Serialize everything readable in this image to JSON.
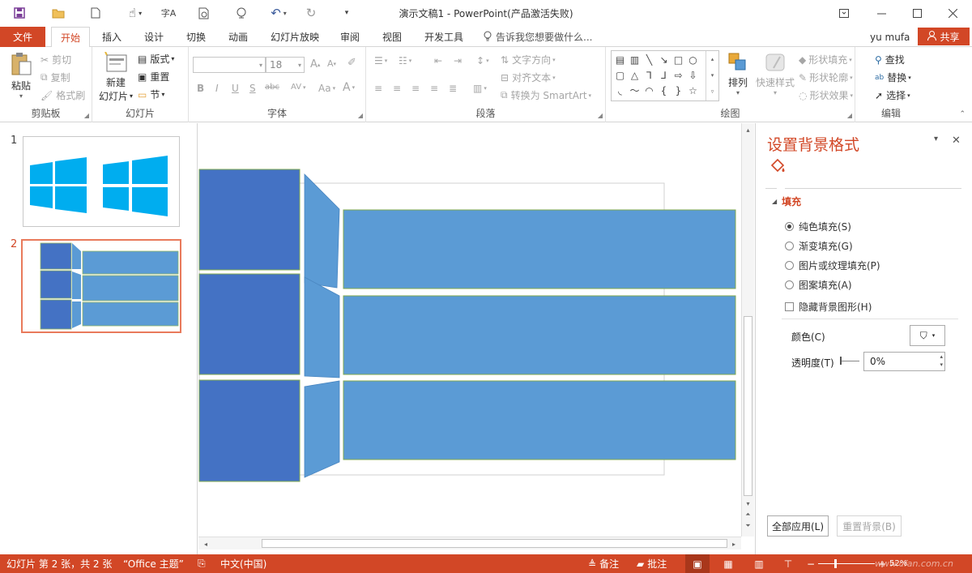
{
  "title_bar": {
    "title": "演示文稿1 - PowerPoint(产品激活失败)",
    "quick_access": [
      "save-icon",
      "open-icon",
      "new-icon",
      "touch-icon",
      "spelling-icon",
      "print-preview-icon",
      "present-icon",
      "undo-icon",
      "redo-icon",
      "customize-icon"
    ],
    "window_buttons": [
      "ribbon-display-icon",
      "minimize-icon",
      "maximize-icon",
      "close-icon"
    ]
  },
  "tabs": {
    "file": "文件",
    "items": [
      "开始",
      "插入",
      "设计",
      "切换",
      "动画",
      "幻灯片放映",
      "审阅",
      "视图",
      "开发工具"
    ],
    "active": "开始",
    "tell_me": "告诉我您想要做什么...",
    "user": "yu mufa",
    "share": "共享"
  },
  "ribbon": {
    "clipboard": {
      "label": "剪贴板",
      "paste": "粘贴",
      "cut": "剪切",
      "copy": "复制",
      "format_painter": "格式刷"
    },
    "slides": {
      "label": "幻灯片",
      "new_slide_line1": "新建",
      "new_slide_line2": "幻灯片",
      "layout": "版式",
      "reset": "重置",
      "section": "节"
    },
    "font": {
      "label": "字体",
      "font_name": "",
      "font_size": "18",
      "bold": "B",
      "italic": "I",
      "underline": "U",
      "shadow": "S",
      "strike": "abc",
      "spacing": "AV",
      "case": "Aa",
      "clear": "A"
    },
    "paragraph": {
      "label": "段落",
      "text_direction": "文字方向",
      "align_text": "对齐文本",
      "smartart": "转换为 SmartArt"
    },
    "drawing": {
      "label": "绘图",
      "arrange": "排列",
      "quick_styles": "快速样式",
      "shape_fill": "形状填充",
      "shape_outline": "形状轮廓",
      "shape_effects": "形状效果"
    },
    "editing": {
      "label": "编辑",
      "find": "查找",
      "replace": "替换",
      "select": "选择"
    }
  },
  "thumbnails": [
    {
      "number": "1"
    },
    {
      "number": "2"
    }
  ],
  "slide_colors": {
    "dark_blue": "#4472c4",
    "light_blue": "#5b9bd5",
    "windows_blue": "#00adef"
  },
  "format_pane": {
    "title": "设置背景格式",
    "section": "填充",
    "options": [
      "纯色填充(S)",
      "渐变填充(G)",
      "图片或纹理填充(P)",
      "图案填充(A)"
    ],
    "selected_option": "纯色填充(S)",
    "hide_background": "隐藏背景图形(H)",
    "color_label": "颜色(C)",
    "transparency_label": "透明度(T)",
    "transparency_value": "0%",
    "apply_all": "全部应用(L)",
    "reset_background": "重置背景(B)"
  },
  "status_bar": {
    "slide_info": "幻灯片 第 2 张，共 2 张",
    "theme": "“Office 主题”",
    "language": "中文(中国)",
    "notes": "备注",
    "comments": "批注",
    "zoom": "52%",
    "watermark": "www.cfan.com.cn"
  }
}
